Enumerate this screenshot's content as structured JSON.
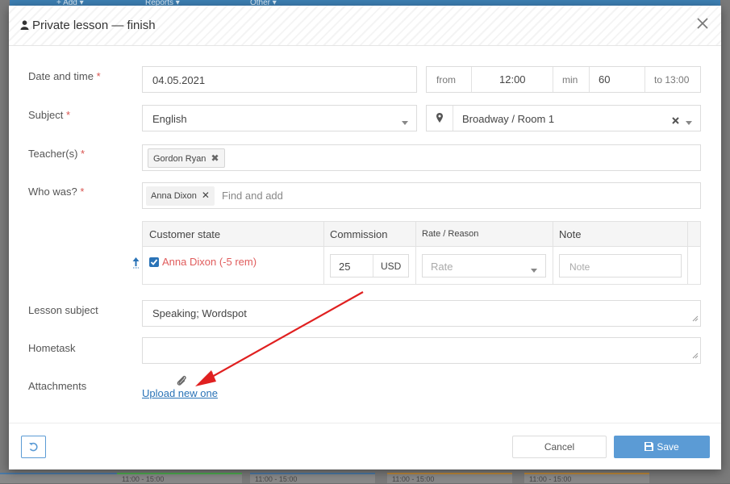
{
  "background": {
    "top_buttons": [
      "+ Add ▾",
      "Reports ▾",
      "Other ▾"
    ],
    "slot_label": "11:00 - 15:00"
  },
  "modal": {
    "title": "Private lesson — finish",
    "fields": {
      "date_label": "Date and time",
      "date_value": "04.05.2021",
      "from_label": "from",
      "from_value": "12:00",
      "min_label": "min",
      "min_value": "60",
      "to_value": "to 13:00",
      "subject_label": "Subject",
      "subject_value": "English",
      "location_value": "Broadway / Room 1",
      "teachers_label": "Teacher(s)",
      "teacher_tag": "Gordon Ryan",
      "who_label": "Who was?",
      "who_tag": "Anna Dixon",
      "who_placeholder": "Find and add",
      "lesson_subject_label": "Lesson subject",
      "lesson_subject_value": "Speaking; Wordspot",
      "hometask_label": "Hometask",
      "attachments_label": "Attachments",
      "upload_link": "Upload new one"
    },
    "customer_table": {
      "headers": [
        "Customer state",
        "Commission",
        "Rate / Reason",
        "Note"
      ],
      "row": {
        "name": "Anna Dixon (-5 rem)",
        "commission": "25",
        "currency": "USD",
        "rate_placeholder": "Rate",
        "note_placeholder": "Note"
      }
    },
    "footer": {
      "cancel_label": "Cancel",
      "save_label": "Save"
    }
  },
  "colors": {
    "primary": "#5b9bd5",
    "required": "#d9534f",
    "customer_name": "#e05c5c",
    "link": "#2a73b7",
    "arrow": "#e02020"
  }
}
